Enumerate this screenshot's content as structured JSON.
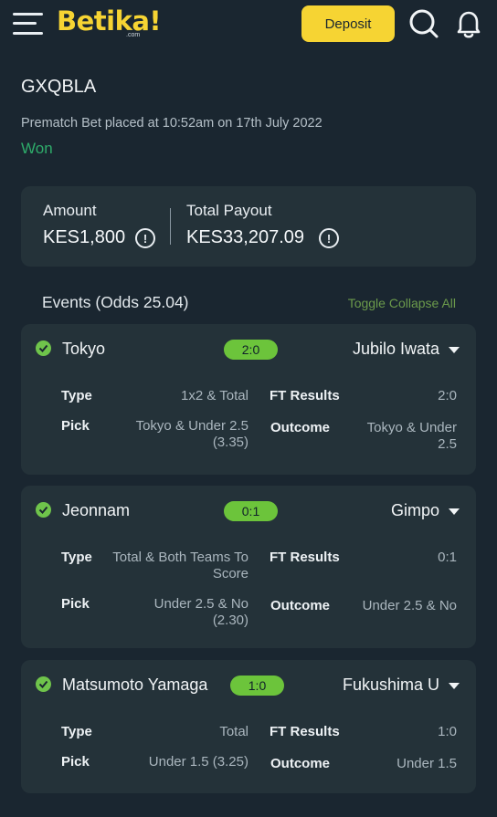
{
  "header": {
    "logo_text": "Betika!",
    "logo_sub": ".com",
    "deposit_label": "Deposit"
  },
  "bet": {
    "code": "GXQBLA",
    "meta": "Prematch Bet placed at 10:52am on 17th July 2022",
    "status": "Won"
  },
  "summary": {
    "amount_label": "Amount",
    "amount_value": "KES1,800",
    "payout_label": "Total Payout",
    "payout_value": "KES33,207.09",
    "info_glyph": "!"
  },
  "events": {
    "title": "Events (Odds 25.04)",
    "toggle_label": "Toggle Collapse All",
    "items": [
      {
        "home": "Tokyo",
        "score": "2:0",
        "away": "Jubilo Iwata",
        "type_label": "Type",
        "type_value": "1x2 & Total",
        "ft_label": "FT Results",
        "ft_value": "2:0",
        "pick_label": "Pick",
        "pick_value": "Tokyo & Under 2.5 (3.35)",
        "outcome_label": "Outcome",
        "outcome_value": "Tokyo & Under 2.5"
      },
      {
        "home": "Jeonnam",
        "score": "0:1",
        "away": "Gimpo",
        "type_label": "Type",
        "type_value": "Total & Both Teams To Score",
        "ft_label": "FT Results",
        "ft_value": "0:1",
        "pick_label": "Pick",
        "pick_value": "Under 2.5 & No (2.30)",
        "outcome_label": "Outcome",
        "outcome_value": "Under 2.5 & No"
      },
      {
        "home": "Matsumoto Yamaga",
        "score": "1:0",
        "away": "Fukushima U",
        "type_label": "Type",
        "type_value": "Total",
        "ft_label": "FT Results",
        "ft_value": "1:0",
        "pick_label": "Pick",
        "pick_value": "Under 1.5 (3.25)",
        "outcome_label": "Outcome",
        "outcome_value": "Under 1.5"
      }
    ]
  },
  "colors": {
    "background": "#1a2630",
    "card": "#243239",
    "accent_yellow": "#f6d433",
    "won_green": "#2eab6a",
    "score_green": "#6cc43b"
  }
}
